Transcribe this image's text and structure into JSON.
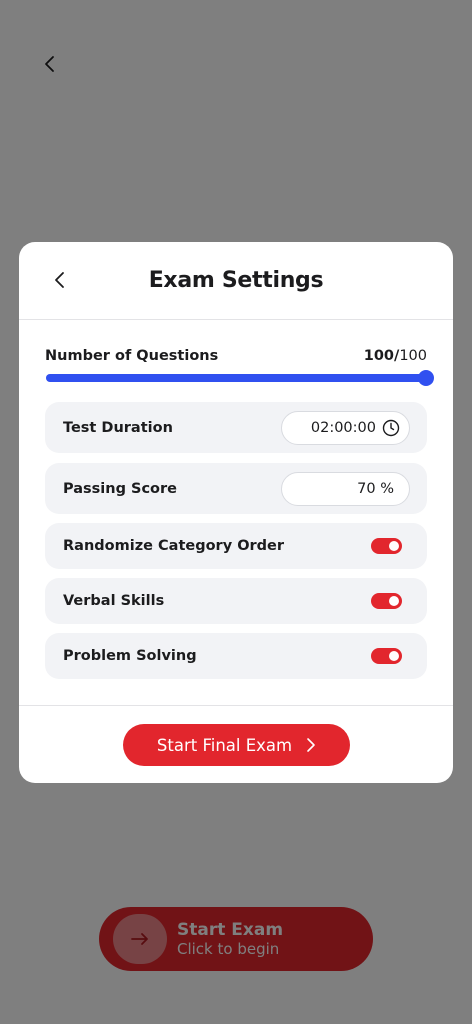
{
  "background": {
    "start_exam": {
      "title": "Start Exam",
      "subtitle": "Click to begin"
    }
  },
  "modal": {
    "title": "Exam Settings",
    "questions": {
      "label": "Number of Questions",
      "current": "100",
      "separator": "/",
      "total": "100",
      "fraction": 1.0
    },
    "settings": [
      {
        "label": "Test Duration",
        "value": "02:00:00"
      },
      {
        "label": "Passing Score",
        "value": "70 %"
      },
      {
        "label": "Randomize Category Order",
        "enabled": true
      },
      {
        "label": "Verbal Skills",
        "enabled": true
      },
      {
        "label": "Problem Solving",
        "enabled": true
      }
    ],
    "start_button": "Start Final Exam"
  },
  "colors": {
    "accent_red": "#e2262d",
    "slider_blue": "#3050f0",
    "row_bg": "#f2f3f6"
  },
  "icons": {
    "back": "chevron-left-icon",
    "clock": "clock-icon",
    "next": "chevron-right-icon",
    "arrow": "arrow-right-icon"
  }
}
